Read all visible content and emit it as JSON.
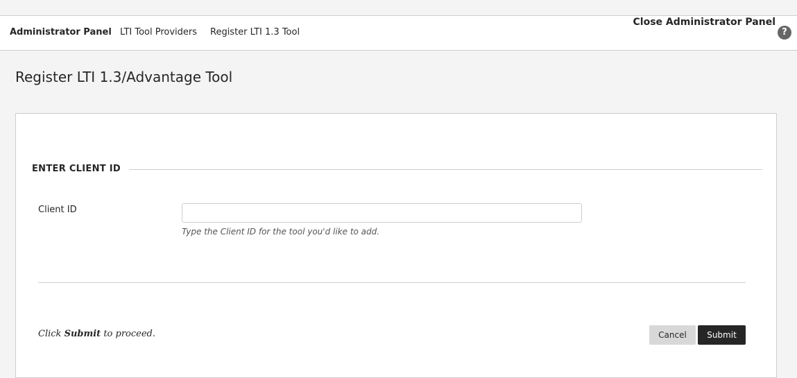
{
  "nav": {
    "breadcrumbs": [
      "Administrator Panel",
      "LTI Tool Providers",
      "Register LTI 1.3 Tool"
    ],
    "close_label": "Close Administrator Panel",
    "help_icon": "question-icon",
    "help_glyph": "?"
  },
  "page": {
    "title": "Register LTI 1.3/Advantage Tool"
  },
  "form": {
    "section_title": "ENTER CLIENT ID",
    "client_id": {
      "label": "Client ID",
      "value": "",
      "placeholder": "",
      "help_text": "Type the Client ID for the tool you'd like to add."
    },
    "footer": {
      "hint_prefix": "Click ",
      "hint_strong": "Submit",
      "hint_suffix": " to proceed.",
      "cancel_label": "Cancel",
      "submit_label": "Submit"
    }
  },
  "colors": {
    "primary_button": "#262626",
    "secondary_button": "#d8d8d8",
    "help_icon_bg": "#666666"
  }
}
